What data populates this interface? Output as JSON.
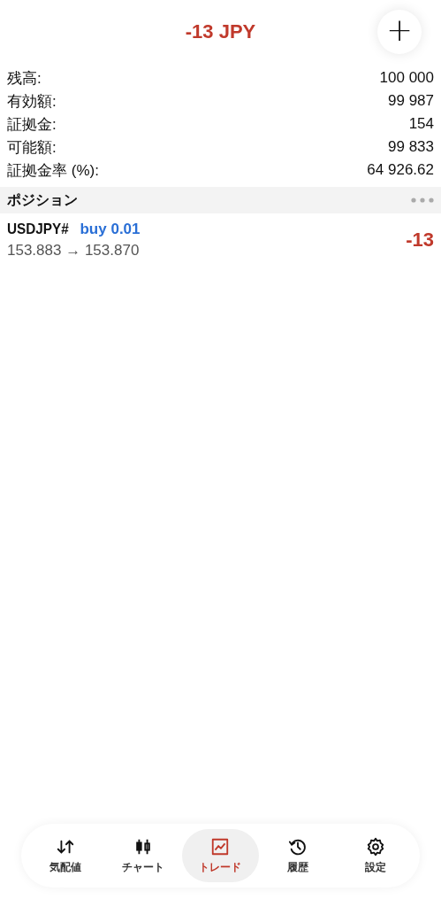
{
  "header": {
    "title": "-13 JPY",
    "add_button": "+"
  },
  "summary": [
    {
      "label": "残高:",
      "value": "100 000"
    },
    {
      "label": "有効額:",
      "value": "99 987"
    },
    {
      "label": "証拠金:",
      "value": "154"
    },
    {
      "label": "可能額:",
      "value": "99 833"
    },
    {
      "label": "証拠金率 (%):",
      "value": "64 926.62"
    }
  ],
  "positions_section": {
    "title": "ポジション"
  },
  "positions": [
    {
      "symbol": "USDJPY#",
      "side": "buy 0.01",
      "prices": "153.883 → 153.870",
      "profit": "-13"
    }
  ],
  "tabs": [
    {
      "kind": "quotes",
      "label": "気配値",
      "selected": false
    },
    {
      "kind": "chart",
      "label": "チャート",
      "selected": false
    },
    {
      "kind": "trade",
      "label": "トレード",
      "selected": true
    },
    {
      "kind": "history",
      "label": "履歴",
      "selected": false
    },
    {
      "kind": "settings",
      "label": "設定",
      "selected": false
    }
  ]
}
